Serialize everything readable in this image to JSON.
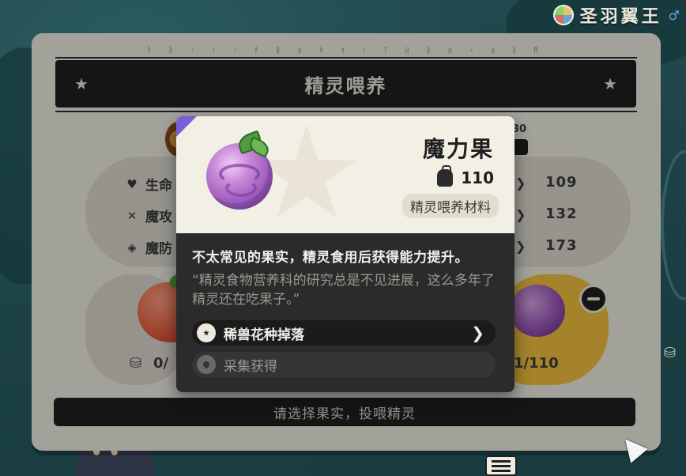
{
  "player": {
    "name": "圣羽翼王",
    "gender_icon": "male-icon"
  },
  "panel": {
    "rune_text": "ᚨ ᚱ ᚲ ᛁ ᚲ ᚨ ᛒ ᛟ ᛋ ᛋ ᛁ ᛏ ᚺ ᚱ ᛟ ᚲ ᛟ ᚱ ᛗ",
    "title": "精灵喂养",
    "stats": [
      {
        "label": "生命",
        "icon": "heart-icon",
        "value": "109"
      },
      {
        "label": "魔攻",
        "icon": "sword-icon",
        "value": "132"
      },
      {
        "label": "魔防",
        "icon": "shield-icon",
        "value": "173"
      }
    ],
    "level_digits": "30",
    "left_count": "0/",
    "right_count": "1/110",
    "bottom_prompt": "请选择果实，投喂精灵"
  },
  "tooltip": {
    "item_name": "魔力果",
    "owned_count": "110",
    "category": "精灵喂养材料",
    "description": "不太常见的果实，精灵食用后获得能力提升。",
    "quote": "“精灵食物营养科的研究总是不见进展，这么多年了精灵还在吃果子。”",
    "sources": [
      {
        "label": "稀兽花种掉落",
        "active": true
      },
      {
        "label": "采集获得",
        "active": false
      }
    ]
  },
  "colors": {
    "panel_bg": "#efede3",
    "dark_bar": "#1f1f1f",
    "accent_purple": "#7b5fd6",
    "accent_yellow": "#f3c23f"
  }
}
